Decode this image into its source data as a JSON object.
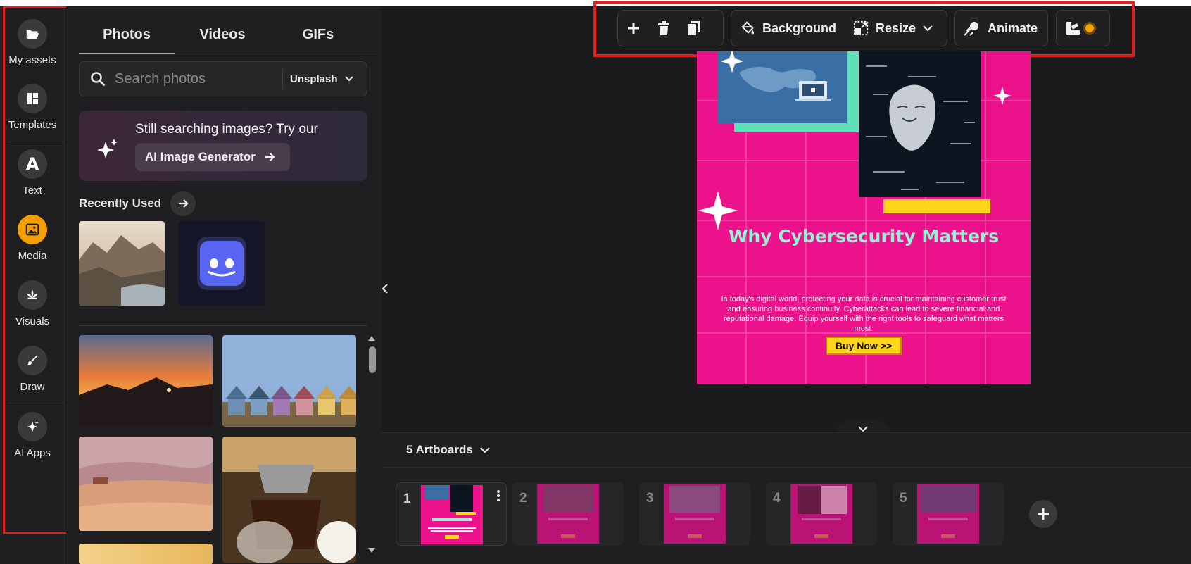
{
  "rail": {
    "items": [
      {
        "label": "My assets",
        "icon": "folder-open-icon"
      },
      {
        "label": "Templates",
        "icon": "layout-icon"
      },
      {
        "label": "Text",
        "icon": "letter-a-icon"
      },
      {
        "label": "Media",
        "icon": "image-icon"
      },
      {
        "label": "Visuals",
        "icon": "lotus-icon"
      },
      {
        "label": "Draw",
        "icon": "brush-icon"
      },
      {
        "label": "AI Apps",
        "icon": "sparkles-icon"
      }
    ],
    "active_index": 3
  },
  "panel": {
    "tabs": [
      "Photos",
      "Videos",
      "GIFs"
    ],
    "active_tab": "Photos",
    "search": {
      "placeholder": "Search photos",
      "value": "",
      "source": "Unsplash"
    },
    "promo": {
      "text": "Still searching images? Try our",
      "button_label": "AI Image Generator"
    },
    "recent_title": "Recently Used"
  },
  "toolbar": {
    "background_label": "Background",
    "resize_label": "Resize",
    "animate_label": "Animate"
  },
  "artboard": {
    "title": "Why Cybersecurity Matters",
    "body": "In today's digital world, protecting your data is crucial for maintaining customer trust and ensuring business continuity. Cyberattacks can lead to severe financial and reputational damage. Equip yourself with the right tools to safeguard what matters most.",
    "cta": "Buy Now >>"
  },
  "pages": {
    "count_label": "5 Artboards",
    "items": [
      "1",
      "2",
      "3",
      "4",
      "5"
    ],
    "active": "1"
  },
  "colors": {
    "accent": "#f5a000",
    "artboard_bg": "#eb128c",
    "title_color": "#9af0d4",
    "highlight_outline": "#e11d1d"
  }
}
